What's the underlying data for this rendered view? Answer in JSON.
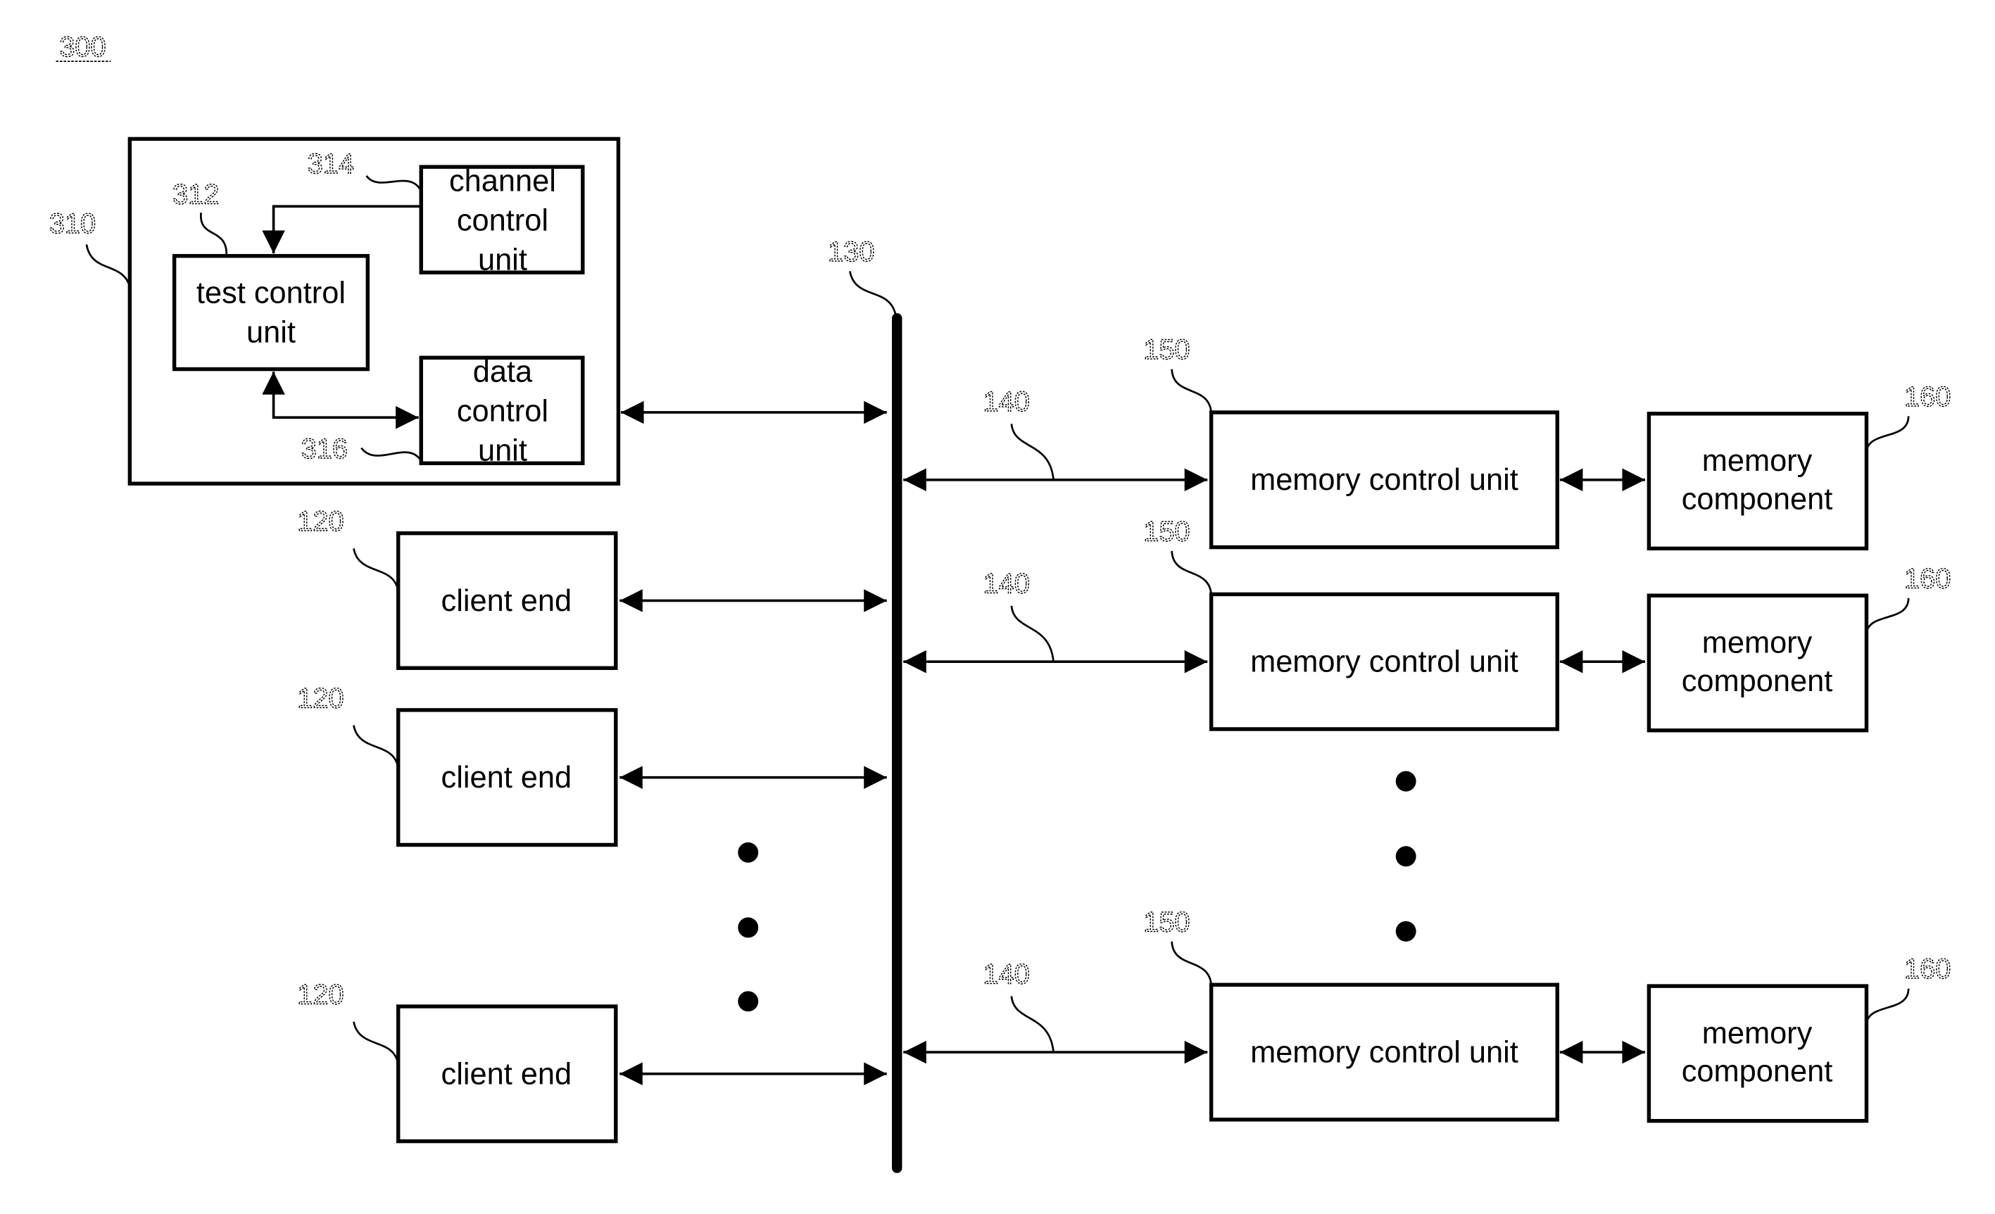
{
  "figure": {
    "number": "300"
  },
  "tester": {
    "ref": "310",
    "test_control": {
      "ref": "312",
      "lines": [
        "test control",
        "unit"
      ]
    },
    "channel_control": {
      "ref": "314",
      "lines": [
        "channel",
        "control",
        "unit"
      ]
    },
    "data_control": {
      "ref": "316",
      "lines": [
        "data",
        "control",
        "unit"
      ]
    }
  },
  "bus": {
    "ref": "130"
  },
  "clients": [
    {
      "ref": "120",
      "label": "client end"
    },
    {
      "ref": "120",
      "label": "client end"
    },
    {
      "ref": "120",
      "label": "client end"
    }
  ],
  "channels": [
    {
      "link_ref": "140",
      "mcu_ref": "150",
      "mcu_label": "memory control unit",
      "mem_ref": "160",
      "mem_lines": [
        "memory",
        "component"
      ]
    },
    {
      "link_ref": "140",
      "mcu_ref": "150",
      "mcu_label": "memory control unit",
      "mem_ref": "160",
      "mem_lines": [
        "memory",
        "component"
      ]
    },
    {
      "link_ref": "140",
      "mcu_ref": "150",
      "mcu_label": "memory control unit",
      "mem_ref": "160",
      "mem_lines": [
        "memory",
        "component"
      ]
    }
  ]
}
